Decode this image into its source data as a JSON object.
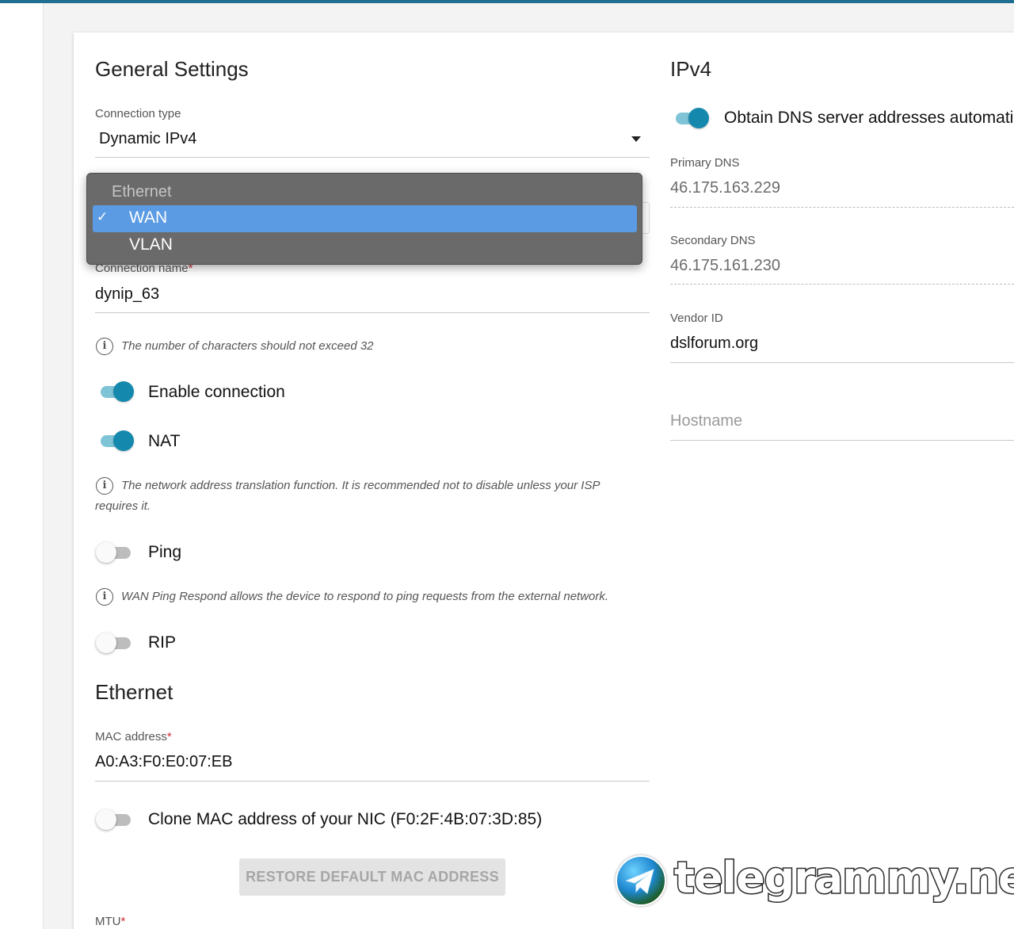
{
  "general": {
    "title": "General Settings",
    "connection_type_label": "Connection type",
    "connection_type_value": "Dynamic IPv4",
    "connection_name_label": "Connection name",
    "required_mark": "*",
    "connection_name_value": "dynip_63",
    "connection_name_hint": "The number of characters should not exceed 32",
    "enable_connection_label": "Enable connection",
    "enable_connection_on": true,
    "nat_label": "NAT",
    "nat_on": true,
    "nat_hint": "The network address translation function. It is recommended not to disable unless your ISP requires it.",
    "ping_label": "Ping",
    "ping_on": false,
    "ping_hint": "WAN Ping Respond allows the device to respond to ping requests from the external network.",
    "rip_label": "RIP",
    "rip_on": false
  },
  "dropdown": {
    "group_label": "Ethernet",
    "items": [
      {
        "label": "WAN",
        "selected": true
      },
      {
        "label": "VLAN",
        "selected": false
      }
    ],
    "check_glyph": "✓"
  },
  "ethernet": {
    "title": "Ethernet",
    "mac_label": "MAC address",
    "mac_value": "A0:A3:F0:E0:07:EB",
    "clone_label": "Clone MAC address of your NIC (F0:2F:4B:07:3D:85)",
    "clone_on": false,
    "restore_button": "RESTORE DEFAULT MAC ADDRESS",
    "mtu_label": "MTU"
  },
  "ipv4": {
    "title": "IPv4",
    "auto_dns_label": "Obtain DNS server addresses automatically",
    "auto_dns_on": true,
    "primary_dns_label": "Primary DNS",
    "primary_dns_value": "46.175.163.229",
    "secondary_dns_label": "Secondary DNS",
    "secondary_dns_value": "46.175.161.230",
    "vendor_id_label": "Vendor ID",
    "vendor_id_value": "dslforum.org",
    "hostname_placeholder": "Hostname"
  },
  "watermark": {
    "text": "telegrammy.net"
  },
  "colors": {
    "accent": "#1589ad",
    "accent_track": "#7ec3d6",
    "dropdown_bg": "#6a6a6a",
    "dropdown_selected": "#5b9be4"
  }
}
